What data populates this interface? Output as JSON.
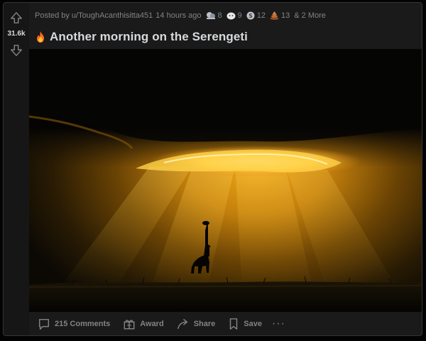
{
  "post": {
    "vote_count": "31.6k",
    "posted_by_prefix": "Posted by",
    "author": "u/ToughAcanthisitta451",
    "time_ago": "14 hours ago",
    "awards": [
      {
        "icon": "helpful-award-icon",
        "count": "8",
        "color": "#b9bfc6"
      },
      {
        "icon": "wholesome-award-icon",
        "count": "9",
        "color": "#e8e8e8"
      },
      {
        "icon": "silver-award-icon",
        "count": "12",
        "color": "#c0c4c8"
      },
      {
        "icon": "poop-award-icon",
        "count": "13",
        "color": "#b8693a"
      }
    ],
    "more_awards": "& 2 More",
    "title": "Another morning on the Serengeti",
    "flair_icon": "fire-icon"
  },
  "actions": {
    "comments": "215 Comments",
    "award": "Award",
    "share": "Share",
    "save": "Save",
    "more": "···"
  },
  "colors": {
    "background": "#030303",
    "card": "#1a1a1b",
    "text": "#d7dadc",
    "muted": "#818384",
    "sun": "#f5b21a"
  }
}
